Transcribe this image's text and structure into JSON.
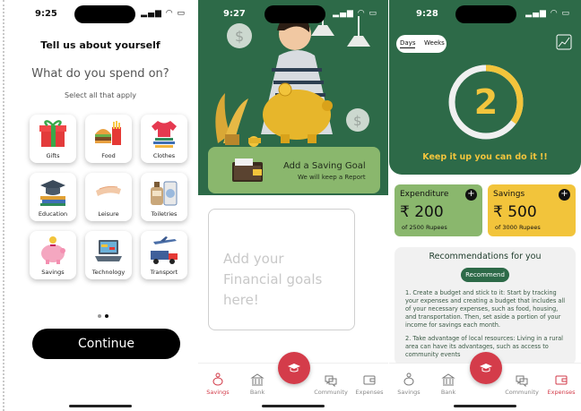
{
  "screen1": {
    "time": "9:25",
    "title": "Tell us about yourself",
    "question": "What do you spend on?",
    "subtitle": "Select all that apply",
    "categories": [
      {
        "label": "Gifts",
        "icon": "gift-icon"
      },
      {
        "label": "Food",
        "icon": "food-icon"
      },
      {
        "label": "Clothes",
        "icon": "clothes-icon"
      },
      {
        "label": "Education",
        "icon": "education-icon"
      },
      {
        "label": "Leisure",
        "icon": "leisure-icon"
      },
      {
        "label": "Toiletries",
        "icon": "toiletries-icon"
      },
      {
        "label": "Savings",
        "icon": "piggy-bank-icon"
      },
      {
        "label": "Technology",
        "icon": "laptop-icon"
      },
      {
        "label": "Transport",
        "icon": "transport-icon"
      }
    ],
    "page_indicator": {
      "pages": 2,
      "current": 2
    },
    "continue_label": "Continue"
  },
  "screen2": {
    "time": "9:27",
    "goal_banner_title": "Add a Saving Goal",
    "goal_banner_subtitle": "We will keep a Report",
    "goals_placeholder": "Add your Financial goals here!",
    "active_tab": "Savings"
  },
  "screen3": {
    "time": "9:28",
    "toggle": {
      "days": "Days",
      "weeks": "Weeks"
    },
    "streak_number": "2",
    "streak_progress": 0.35,
    "encouragement": "Keep it up you can do it !!",
    "expenditure": {
      "title": "Expenditure",
      "amount": "₹ 200",
      "subtitle": "of 2500 Rupees"
    },
    "savings": {
      "title": "Savings",
      "amount": "₹ 500",
      "subtitle": "of 3000 Rupees"
    },
    "recommendations_title": "Recommendations for you",
    "recommend_button": "Recommend",
    "recommendations": [
      "1. Create a budget and stick to it: Start by tracking your expenses and creating a budget that includes all of your necessary expenses, such as food, housing, and transportation. Then, set aside a portion of your income for savings each month.",
      "2. Take advantage of local resources: Living in a rural area can have its advantages, such as access to community events"
    ],
    "active_tab": "Expenses"
  },
  "tabs": {
    "savings": "Savings",
    "bank": "Bank",
    "community": "Community",
    "expenses": "Expenses"
  },
  "colors": {
    "green": "#2d6a48",
    "light_green": "#8ab76d",
    "yellow": "#f2c43b",
    "red": "#d43c4a"
  }
}
